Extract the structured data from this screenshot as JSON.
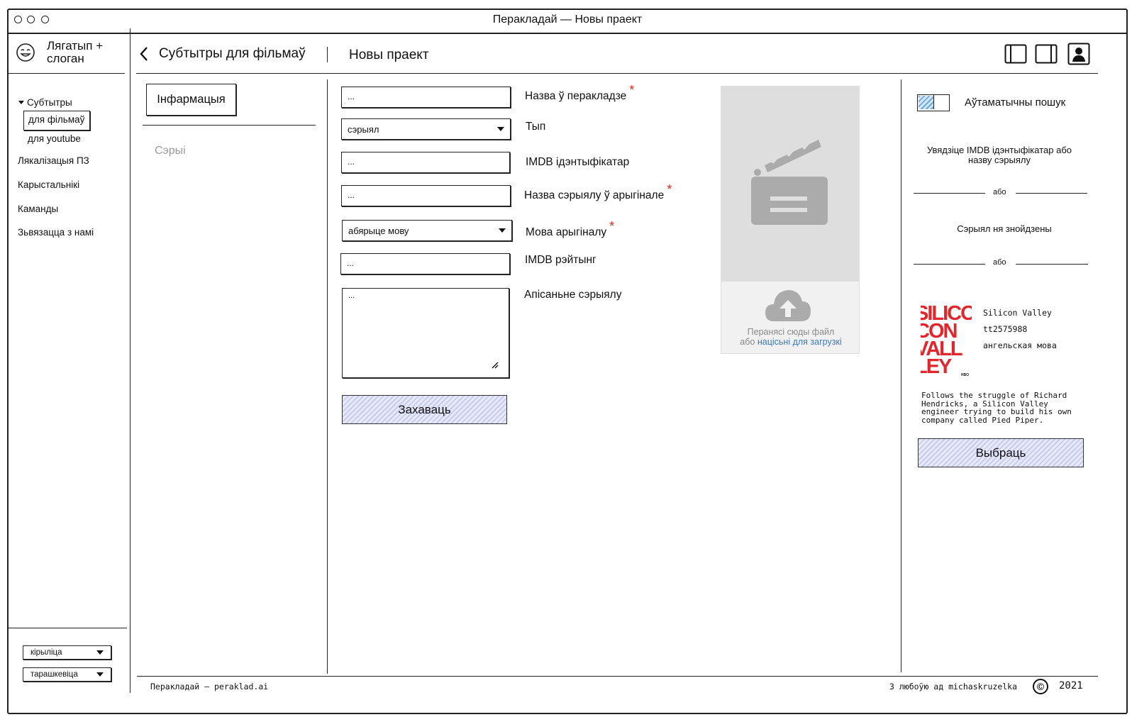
{
  "window": {
    "title": "Перакладай — Новы праект"
  },
  "logo": {
    "text": "Лягатып + слоган"
  },
  "header": {
    "breadcrumb": "Субтытры для фільмаў",
    "page_title": "Новы праект"
  },
  "sidebar": {
    "group_label": "Субтытры",
    "sub_items": [
      "для фільмаў",
      "для youtube"
    ],
    "items": [
      "Лякалізацыя ПЗ",
      "Карыстальнікі",
      "Каманды",
      "Зьвязацца з намі"
    ],
    "script_select": "кірыліца",
    "orthography_select": "тарашкевіца"
  },
  "tabs": {
    "active": "Інфармацыя",
    "inactive": "Сэрыі"
  },
  "form": {
    "placeholder": "...",
    "title_label": "Назва ў перакладзе",
    "type_label": "Тып",
    "type_value": "сэрыял",
    "imdb_id_label": "IMDB ідэнтыфікатар",
    "original_title_label": "Назва сэрыялу ў арыгінале",
    "language_label": "Мова арыгіналу",
    "language_value": "абярыце мову",
    "rating_label": "IMDB рэйтынг",
    "description_label": "Апісаньне сэрыялу",
    "save_label": "Захаваць"
  },
  "upload": {
    "line1": "Перанясі сюды файл",
    "line2_prefix": "або",
    "line2_link": "націсьні для загрузкі"
  },
  "right_panel": {
    "auto_search_label": "Аўтаматычны пошук",
    "hint": "Увядзіце IMDB ідэнтыфікатар або назву сэрыялу",
    "or_label": "або",
    "not_found": "Сэрыял ня знойдзены",
    "result": {
      "title": "Silicon Valley",
      "imdb_id": "tt2575988",
      "language": "ангельская мова",
      "description": "Follows the struggle of Richard Hendricks, a Silicon Valley engineer trying to build his own company called Pied Piper."
    },
    "poster_text": [
      "SILICON",
      "CON",
      "VALL",
      "LEY"
    ],
    "poster_small": "HBO",
    "select_label": "Выбраць"
  },
  "footer": {
    "left": "Перакладай — peraklad.ai",
    "credit": "З любоўю ад michaskruzelka",
    "copyright_symbol": "©",
    "year": "2021"
  },
  "colors": {
    "required": "#e0261a",
    "link": "#3a7bc8",
    "button_hatch": "#c8cdef",
    "poster_red": "#e3262b"
  }
}
